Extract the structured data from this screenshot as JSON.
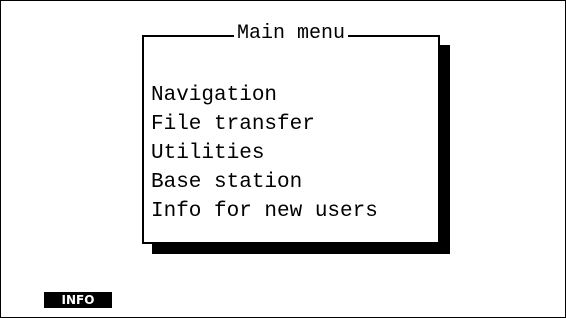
{
  "main_menu": {
    "title": "Main menu",
    "items": [
      {
        "label": "Navigation"
      },
      {
        "label": "File transfer"
      },
      {
        "label": "Utilities"
      },
      {
        "label": "Base station"
      },
      {
        "label": "Info for new users"
      }
    ]
  },
  "status": {
    "info_label": "INFO"
  },
  "colors": {
    "foreground": "#000000",
    "background": "#ffffff"
  }
}
